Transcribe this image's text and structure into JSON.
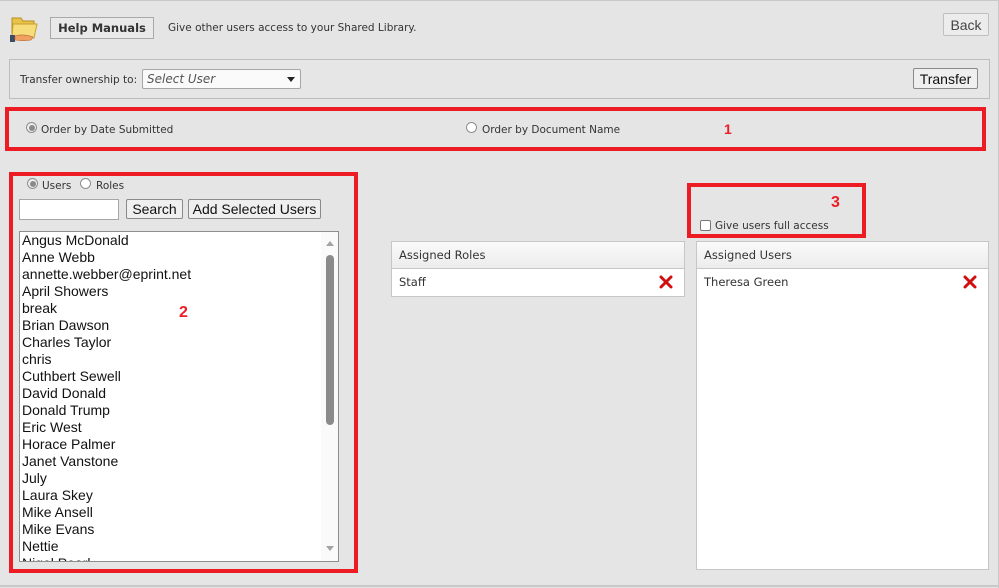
{
  "header": {
    "library_name": "Help Manuals",
    "description": "Give other users access to your Shared Library.",
    "back_label": "Back",
    "icon": "shared-folder-icon"
  },
  "transfer": {
    "label": "Transfer ownership to:",
    "select_value": "Select User",
    "button_label": "Transfer"
  },
  "ordering": {
    "options": [
      {
        "label": "Order by Date Submitted",
        "checked": true
      },
      {
        "label": "Order by Document Name",
        "checked": false
      }
    ]
  },
  "annotations": {
    "box1": "1",
    "box2": "2",
    "box3": "3",
    "color": "#ed1c24"
  },
  "picker": {
    "mode_options": [
      {
        "label": "Users",
        "checked": true
      },
      {
        "label": "Roles",
        "checked": false
      }
    ],
    "search_value": "",
    "search_label": "Search",
    "add_label": "Add Selected Users",
    "users": [
      "Angus McDonald",
      "Anne Webb",
      "annette.webber@eprint.net",
      "April Showers",
      "break",
      "Brian Dawson",
      "Charles Taylor",
      "chris",
      "Cuthbert Sewell",
      "David Donald",
      "Donald Trump",
      "Eric West",
      "Horace Palmer",
      "Janet Vanstone",
      "July",
      "Laura Skey",
      "Mike Ansell",
      "Mike Evans",
      "Nettie",
      "Nigel Pearl"
    ]
  },
  "full_access": {
    "label": "Give users full access",
    "checked": false
  },
  "assigned_roles": {
    "header": "Assigned Roles",
    "items": [
      "Staff"
    ]
  },
  "assigned_users": {
    "header": "Assigned Users",
    "items": [
      "Theresa Green"
    ]
  }
}
